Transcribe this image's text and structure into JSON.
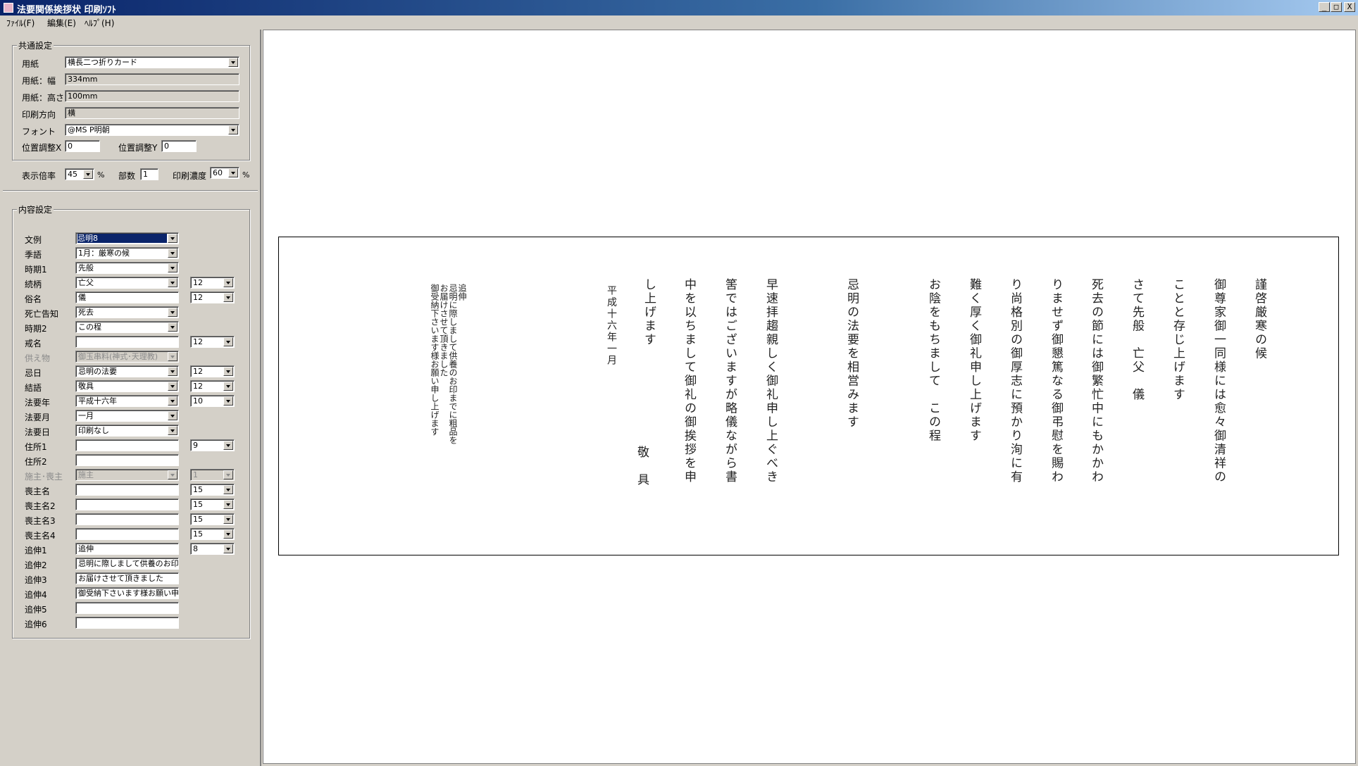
{
  "window": {
    "title": "法要関係挨拶状  印刷ｿﾌﾄ",
    "minimize": "_",
    "maximize": "□",
    "close": "X"
  },
  "menu": [
    "ﾌｧｲﾙ(F)",
    "編集(E)",
    "ﾍﾙﾌﾟ(H)"
  ],
  "common": {
    "group_label": "共通設定",
    "paper_label": "用紙",
    "paper_value": "横長二つ折りカード",
    "width_label": "用紙：幅",
    "width_value": "334mm",
    "height_label": "用紙：高さ",
    "height_value": "100mm",
    "orient_label": "印刷方向",
    "orient_value": "横",
    "font_label": "フォント",
    "font_value": "@MS P明朝",
    "adjx_label": "位置調整X",
    "adjx_value": "0",
    "adjy_label": "位置調整Y",
    "adjy_value": "0"
  },
  "view": {
    "zoom_label": "表示倍率",
    "zoom_value": "45",
    "zoom_unit": "%",
    "copies_label": "部数",
    "copies_value": "1",
    "density_label": "印刷濃度",
    "density_value": "60",
    "density_unit": "%"
  },
  "content": {
    "group_label": "内容設定",
    "rows": [
      {
        "label": "文例",
        "value": "忌明8",
        "type": "combo",
        "selected": true
      },
      {
        "label": "季語",
        "value": " 1月：厳寒の候",
        "type": "combo"
      },
      {
        "label": "時期1",
        "value": "先般",
        "type": "combo"
      },
      {
        "label": "続柄",
        "value": "亡父",
        "type": "combo",
        "size": "12"
      },
      {
        "label": "俗名",
        "value": "儀",
        "type": "field",
        "size": "12"
      },
      {
        "label": "死亡告知",
        "value": "死去",
        "type": "combo"
      },
      {
        "label": "時期2",
        "value": "この程",
        "type": "combo"
      },
      {
        "label": "戒名",
        "value": "",
        "type": "field",
        "size": "12"
      },
      {
        "label": "供え物",
        "value": "御玉串料(神式･天理教)",
        "type": "combo",
        "disabled": true
      },
      {
        "label": "忌日",
        "value": "忌明の法要",
        "type": "combo",
        "size": "12"
      },
      {
        "label": "結語",
        "value": "敬具",
        "type": "combo",
        "size": "12"
      },
      {
        "label": "法要年",
        "value": "平成十六年",
        "type": "combo",
        "size": "10"
      },
      {
        "label": "法要月",
        "value": "一月",
        "type": "combo"
      },
      {
        "label": "法要日",
        "value": "印刷なし",
        "type": "combo"
      },
      {
        "label": "住所1",
        "value": "",
        "type": "field",
        "size": "9"
      },
      {
        "label": "住所2",
        "value": "",
        "type": "field"
      },
      {
        "label": "施主･喪主",
        "value": "施主",
        "type": "combo",
        "disabled": true,
        "size": "1"
      },
      {
        "label": "喪主名",
        "value": "",
        "type": "field",
        "size": "15"
      },
      {
        "label": "喪主名2",
        "value": "",
        "type": "field",
        "size": "15"
      },
      {
        "label": "喪主名3",
        "value": "",
        "type": "field",
        "size": "15"
      },
      {
        "label": "喪主名4",
        "value": "",
        "type": "field",
        "size": "15"
      },
      {
        "label": "追伸1",
        "value": "追伸",
        "type": "field",
        "size": "8"
      },
      {
        "label": "追伸2",
        "value": "忌明に際しまして供養のお印",
        "type": "field"
      },
      {
        "label": "追伸3",
        "value": "お届けさせて頂きました",
        "type": "field"
      },
      {
        "label": "追伸4",
        "value": "御受納下さいます様お願い申",
        "type": "field"
      },
      {
        "label": "追伸5",
        "value": "",
        "type": "field"
      },
      {
        "label": "追伸6",
        "value": "",
        "type": "field"
      }
    ]
  },
  "letter": {
    "columns": [
      "謹啓厳寒の候",
      "御尊家御一同様には愈々御清祥の",
      "ことと存じ上げます",
      "さて先般　亡父　儀",
      "死去の節には御繁忙中にもかかわ",
      "りませず御懇篤なる御弔慰を賜わ",
      "り尚格別の御厚志に預かり洵に有",
      "難く厚く御礼申し上げます",
      "お陰をもちまして　この程",
      "忌明の法要を相営みます",
      "早速拝趨親しく御礼申し上ぐべき",
      "筈ではございますが略儀ながら書",
      "中を以ちまして御礼の御挨拶を申",
      "し上げます"
    ],
    "closing": "敬　具",
    "date": "平成十六年一月",
    "postscript": [
      "追伸",
      "忌明に際しまして供養のお印までに粗品を",
      "お届けさせて頂きました",
      "御受納下さいます様お願い申し上げます"
    ]
  }
}
